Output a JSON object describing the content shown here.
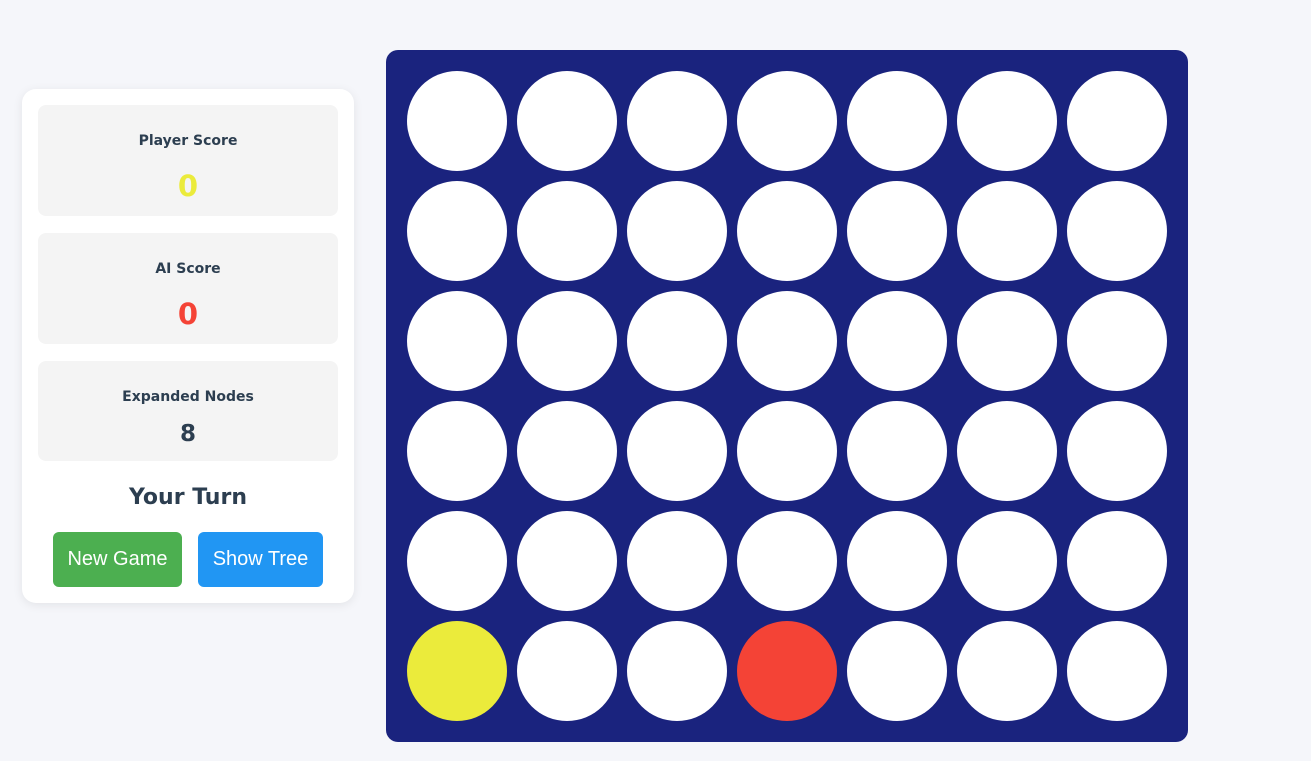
{
  "scores": {
    "player": {
      "label": "Player Score",
      "value": "0",
      "color": "#ebeb3b"
    },
    "ai": {
      "label": "AI Score",
      "value": "0",
      "color": "#f44336"
    },
    "nodes": {
      "label": "Expanded Nodes",
      "value": "8",
      "color": "#2c3e50"
    }
  },
  "status": {
    "turn_text": "Your Turn"
  },
  "buttons": {
    "new_game": "New Game",
    "show_tree": "Show Tree"
  },
  "board": {
    "rows": 6,
    "cols": 7,
    "colors": {
      "empty": "#ffffff",
      "player": "#ebeb3b",
      "ai": "#f44336",
      "board": "#1a237e"
    },
    "cells": [
      [
        "",
        "",
        "",
        "",
        "",
        "",
        ""
      ],
      [
        "",
        "",
        "",
        "",
        "",
        "",
        ""
      ],
      [
        "",
        "",
        "",
        "",
        "",
        "",
        ""
      ],
      [
        "",
        "",
        "",
        "",
        "",
        "",
        ""
      ],
      [
        "",
        "",
        "",
        "",
        "",
        "",
        ""
      ],
      [
        "player",
        "",
        "",
        "ai",
        "",
        "",
        ""
      ]
    ]
  }
}
